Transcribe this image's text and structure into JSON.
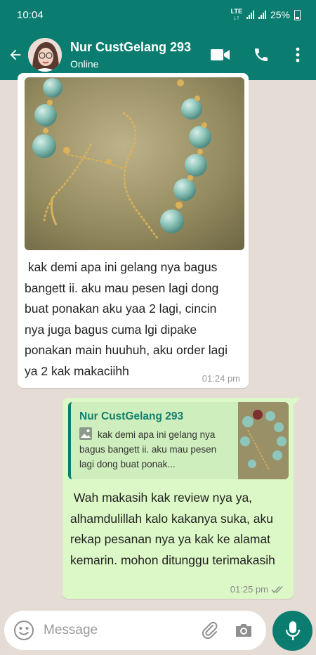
{
  "status_bar": {
    "time": "10:04",
    "network": "LTE",
    "battery": "25%"
  },
  "header": {
    "contact_name": "Nur CustGelang 293",
    "presence": "Online"
  },
  "messages": {
    "incoming": {
      "text": " kak demi apa ini gelang nya bagus bangett ii. aku mau pesen lagi dong buat ponakan aku yaa 2 lagi, cincin nya juga bagus cuma lgi dipake ponakan main huuhuh, aku order lagi ya 2 kak makaciihh",
      "time": "01:24 pm"
    },
    "outgoing": {
      "quoted_name": "Nur CustGelang 293",
      "quoted_text": "kak demi apa ini gelang nya bagus bangett ii. aku mau pesen lagi dong buat ponak...",
      "text": " Wah makasih kak review nya ya, alhamdulillah kalo kakanya suka, aku rekap pesanan nya ya kak ke alamat kemarin. mohon ditunggu terimakasih",
      "time": "01:25 pm",
      "receipt": "double-check-icon"
    }
  },
  "composer": {
    "placeholder": "Message"
  },
  "colors": {
    "header": "#0a7d70",
    "chat_bg": "#e5ddd5",
    "outgoing_bubble": "#dcf8c6",
    "quote_name": "#12806f"
  }
}
